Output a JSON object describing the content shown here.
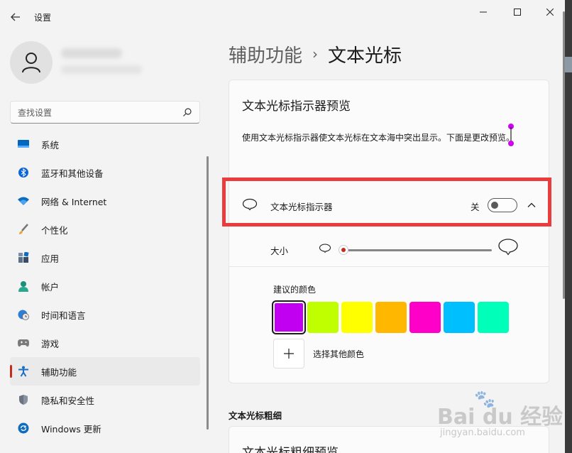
{
  "window": {
    "title": "设置"
  },
  "sidebar": {
    "search_placeholder": "查找设置",
    "items": [
      {
        "label": "系统",
        "icon": "monitor-icon"
      },
      {
        "label": "蓝牙和其他设备",
        "icon": "bluetooth-icon"
      },
      {
        "label": "网络 & Internet",
        "icon": "wifi-icon"
      },
      {
        "label": "个性化",
        "icon": "brush-icon"
      },
      {
        "label": "应用",
        "icon": "apps-icon"
      },
      {
        "label": "帐户",
        "icon": "account-icon"
      },
      {
        "label": "时间和语言",
        "icon": "globe-clock-icon"
      },
      {
        "label": "游戏",
        "icon": "gamepad-icon"
      },
      {
        "label": "辅助功能",
        "icon": "accessibility-icon",
        "active": true
      },
      {
        "label": "隐私和安全性",
        "icon": "shield-icon"
      },
      {
        "label": "Windows 更新",
        "icon": "update-icon"
      }
    ]
  },
  "breadcrumb": {
    "parent": "辅助功能",
    "separator": "›",
    "current": "文本光标"
  },
  "preview_card": {
    "title": "文本光标指示器预览",
    "description": "使用文本光标指示器使文本光标在文本海中突出显示。下面是更改预览。"
  },
  "indicator": {
    "label": "文本光标指示器",
    "state_text": "关",
    "toggle_on": false
  },
  "size": {
    "label": "大小",
    "value_percent": 0
  },
  "colors": {
    "title": "建议的颜色",
    "swatches": [
      "#c100f2",
      "#bfff00",
      "#ffff00",
      "#ffb700",
      "#ff00c8",
      "#00bfff",
      "#00ffb9"
    ],
    "selected_index": 0,
    "add_label": "选择其他颜色"
  },
  "thickness": {
    "section_title": "文本光标粗细",
    "card_title": "文本光标粗细预览"
  },
  "watermark": {
    "brand": "Bai du 经验",
    "sub": "jingyan.baidu.com"
  }
}
